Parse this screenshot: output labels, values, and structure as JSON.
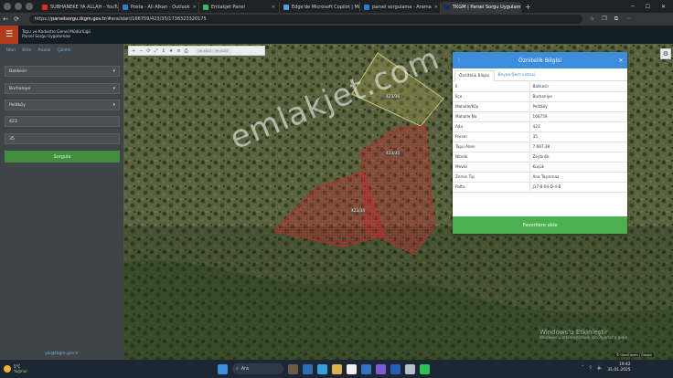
{
  "browser": {
    "tabs": [
      {
        "label": "SUBHANEKE YA ALLAH - YouTube",
        "favicon_color": "#e02b2b"
      },
      {
        "label": "Posta - Ali Alkan - Outlook",
        "favicon_color": "#2b7cd3"
      },
      {
        "label": "Emlakjet Panel",
        "favicon_color": "#3cb371"
      },
      {
        "label": "Edge'de Microsoft Copilot | Micr",
        "favicon_color": "#4aa3df"
      },
      {
        "label": "parsel sorgulama - Arama",
        "favicon_color": "#2b7cd3"
      },
      {
        "label": "TKGM | Parsel Sorgu Uygulaması",
        "favicon_color": "#1b2b5a"
      }
    ],
    "active_tab_index": 5,
    "url_prefix": "https://",
    "url_host": "parselsorgu.tkgm.gov.tr",
    "url_path": "/#ara/idari/166759/423/35/1738323320175"
  },
  "app": {
    "title_line1": "Tapu ve Kadastro Genel Müdürlüğü",
    "title_line2": "Parsel Sorgu Uygulaması",
    "menu_icon": "☰"
  },
  "sidebar": {
    "tabs": [
      "İdari",
      "Kitle",
      "Analiz",
      "Çizimli"
    ],
    "fields": [
      {
        "value": "Balıkesir",
        "has_caret": true
      },
      {
        "value": "Burhaniye",
        "has_caret": true
      },
      {
        "value": "Pelitköy",
        "has_caret": true
      },
      {
        "value": "423",
        "has_caret": false
      },
      {
        "value": "35",
        "has_caret": false
      }
    ],
    "search_button": "Sorgula",
    "footer_email": "yki@tkgm.gov.tr"
  },
  "map": {
    "toolbar_coord": "26.4812 : 39.4120",
    "parcel_labels": [
      "423/36",
      "423/35",
      "423/34"
    ],
    "watermark": "emlakjet.com",
    "activate_line1": "Windows'u Etkinleştir",
    "activate_line2": "Windows'u etkinleştirmek için Ayarlar'a gidin.",
    "attribution": "© OpenLayers | Google"
  },
  "panel": {
    "title": "Öznitelik Bilgisi",
    "tabs": [
      "Öznitelik Bilgisi",
      "Beyan/Şerh Listesi"
    ],
    "rows": [
      {
        "key": "İl",
        "value": "Balıkesir"
      },
      {
        "key": "İlçe",
        "value": "Burhaniye"
      },
      {
        "key": "Mahalle/Köy",
        "value": "Pelitköy"
      },
      {
        "key": "Mahalle No",
        "value": "166759"
      },
      {
        "key": "Ada",
        "value": "423"
      },
      {
        "key": "Parsel",
        "value": "35"
      },
      {
        "key": "Tapu Alanı",
        "value": "7.687,38"
      },
      {
        "key": "Nitelik",
        "value": "Zeytinlik"
      },
      {
        "key": "Mevkii",
        "value": "Küçük"
      },
      {
        "key": "Zemin Tip",
        "value": "Ana Taşınmaz"
      },
      {
        "key": "Pafta",
        "value": "J17-B-04-D-4-B"
      }
    ],
    "favorite_button": "Favorilere ekle"
  },
  "taskbar": {
    "weather_temp": "5°C",
    "weather_desc": "Yağmur",
    "search_label": "Ara",
    "clock_time": "19:42",
    "clock_date": "31.01.2025",
    "colors": {
      "accent_red": "#b23b1e",
      "panel_blue": "#3c8ddc",
      "green": "#4caf50"
    }
  }
}
